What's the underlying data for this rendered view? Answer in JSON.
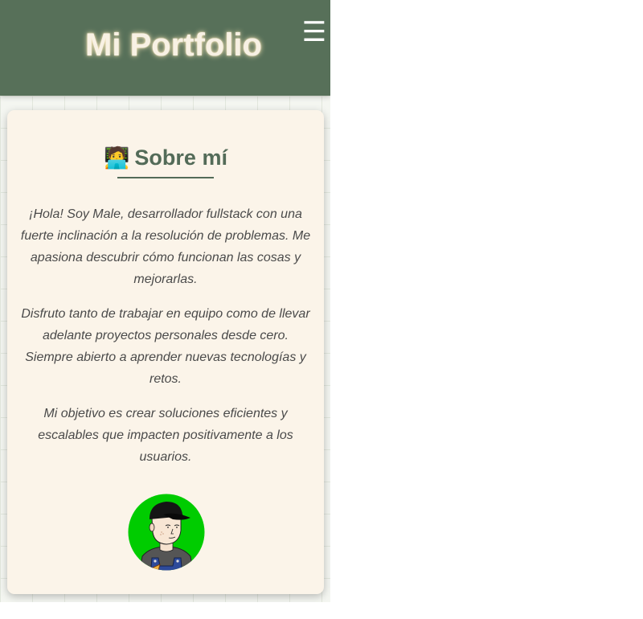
{
  "header": {
    "title": "Mi Portfolio",
    "menu_icon": "☰"
  },
  "about": {
    "emoji": "🧑‍💻",
    "title": "Sobre mí",
    "paragraphs": [
      "¡Hola! Soy Male, desarrollador fullstack con una fuerte inclinación a la resolución de problemas. Me apasiona descubrir cómo funcionan las cosas y mejorarlas.",
      "Disfruto tanto de trabajar en equipo como de llevar adelante proyectos personales desde cero. Siempre abierto a aprender nuevas tecnologías y retos.",
      "Mi objetivo es crear soluciones eficientes y escalables que impacten positivamente a los usuarios."
    ]
  },
  "colors": {
    "header_bg": "#577059",
    "card_bg": "#fbf4e9",
    "accent": "#536b58",
    "avatar_bg": "#00cc00"
  },
  "icons": [
    "hamburger-menu-icon",
    "technologist-emoji-icon",
    "avatar-illustration"
  ]
}
